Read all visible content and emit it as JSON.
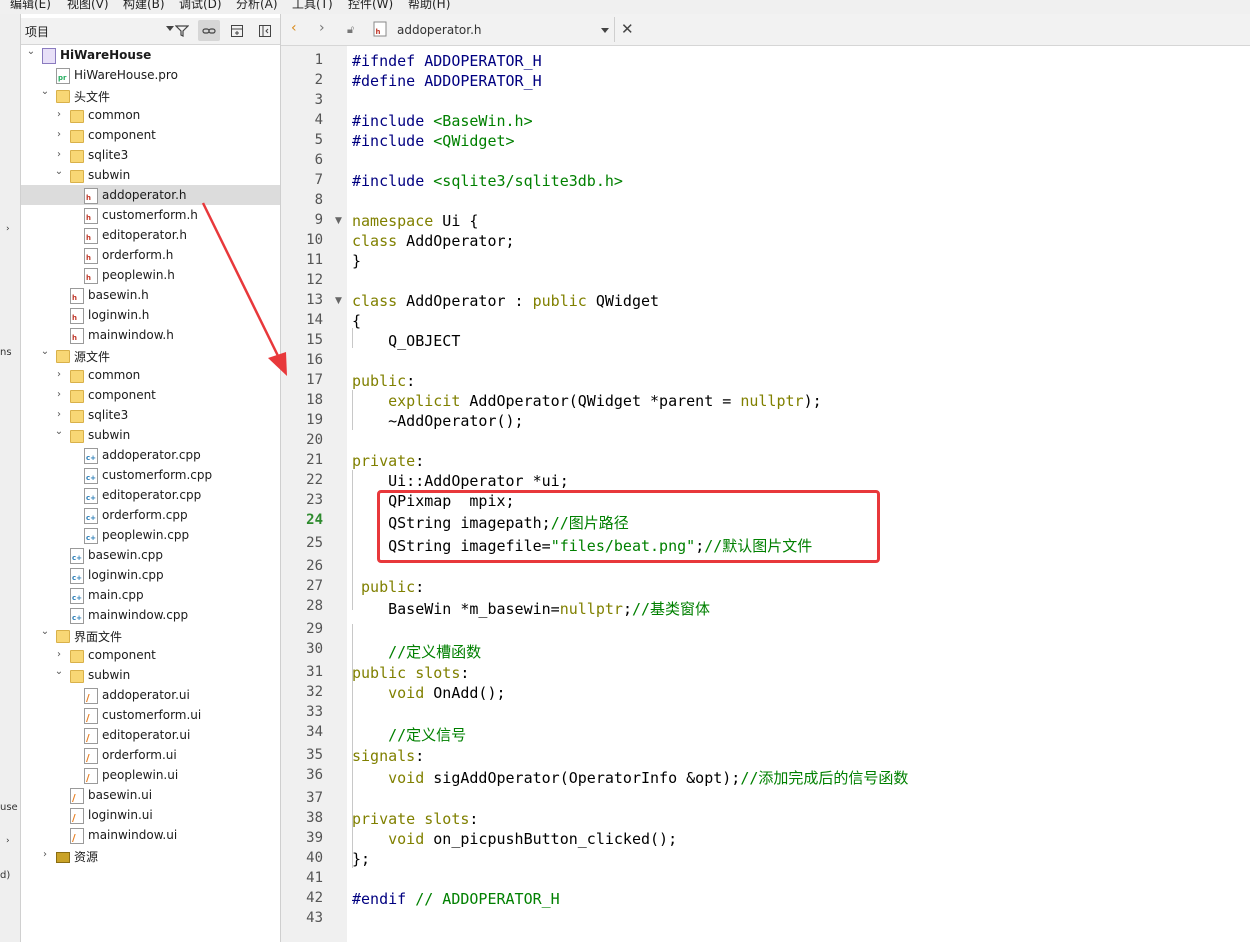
{
  "menubar": {
    "items": [
      "编辑(E)",
      "视图(V)",
      "构建(B)",
      "调试(D)",
      "分析(A)",
      "工具(T)",
      "控件(W)",
      "帮助(H)"
    ]
  },
  "left_strip": {
    "fragments": [
      "ns",
      "use",
      "d)"
    ]
  },
  "project_pane": {
    "title": "项目",
    "tree": [
      {
        "label": "HiWareHouse",
        "icon": "project-icon",
        "expanded": true
      },
      {
        "label": "HiWareHouse.pro",
        "icon": "pro-file-icon"
      },
      {
        "label": "头文件",
        "icon": "headers-folder-icon",
        "expanded": true
      },
      {
        "label": "common",
        "icon": "folder-icon"
      },
      {
        "label": "component",
        "icon": "folder-icon"
      },
      {
        "label": "sqlite3",
        "icon": "folder-icon"
      },
      {
        "label": "subwin",
        "icon": "folder-icon",
        "expanded": true
      },
      {
        "label": "addoperator.h",
        "icon": "header-file-icon",
        "selected": true
      },
      {
        "label": "customerform.h",
        "icon": "header-file-icon"
      },
      {
        "label": "editoperator.h",
        "icon": "header-file-icon"
      },
      {
        "label": "orderform.h",
        "icon": "header-file-icon"
      },
      {
        "label": "peoplewin.h",
        "icon": "header-file-icon"
      },
      {
        "label": "basewin.h",
        "icon": "header-file-icon"
      },
      {
        "label": "loginwin.h",
        "icon": "header-file-icon"
      },
      {
        "label": "mainwindow.h",
        "icon": "header-file-icon"
      },
      {
        "label": "源文件",
        "icon": "sources-folder-icon",
        "expanded": true
      },
      {
        "label": "common",
        "icon": "folder-icon"
      },
      {
        "label": "component",
        "icon": "folder-icon"
      },
      {
        "label": "sqlite3",
        "icon": "folder-icon"
      },
      {
        "label": "subwin",
        "icon": "folder-icon",
        "expanded": true
      },
      {
        "label": "addoperator.cpp",
        "icon": "cpp-file-icon"
      },
      {
        "label": "customerform.cpp",
        "icon": "cpp-file-icon"
      },
      {
        "label": "editoperator.cpp",
        "icon": "cpp-file-icon"
      },
      {
        "label": "orderform.cpp",
        "icon": "cpp-file-icon"
      },
      {
        "label": "peoplewin.cpp",
        "icon": "cpp-file-icon"
      },
      {
        "label": "basewin.cpp",
        "icon": "cpp-file-icon"
      },
      {
        "label": "loginwin.cpp",
        "icon": "cpp-file-icon"
      },
      {
        "label": "main.cpp",
        "icon": "cpp-file-icon"
      },
      {
        "label": "mainwindow.cpp",
        "icon": "cpp-file-icon"
      },
      {
        "label": "界面文件",
        "icon": "forms-folder-icon",
        "expanded": true
      },
      {
        "label": "component",
        "icon": "folder-icon"
      },
      {
        "label": "subwin",
        "icon": "folder-icon",
        "expanded": true
      },
      {
        "label": "addoperator.ui",
        "icon": "ui-file-icon"
      },
      {
        "label": "customerform.ui",
        "icon": "ui-file-icon"
      },
      {
        "label": "editoperator.ui",
        "icon": "ui-file-icon"
      },
      {
        "label": "orderform.ui",
        "icon": "ui-file-icon"
      },
      {
        "label": "peoplewin.ui",
        "icon": "ui-file-icon"
      },
      {
        "label": "basewin.ui",
        "icon": "ui-file-icon"
      },
      {
        "label": "loginwin.ui",
        "icon": "ui-file-icon"
      },
      {
        "label": "mainwindow.ui",
        "icon": "ui-file-icon"
      },
      {
        "label": "资源",
        "icon": "resources-lock-icon",
        "expanded": false
      }
    ]
  },
  "editor": {
    "file_name": "addoperator.h",
    "current_line": "24",
    "lines": [
      {
        "n": "1"
      },
      {
        "n": "2"
      },
      {
        "n": "3"
      },
      {
        "n": "4"
      },
      {
        "n": "5"
      },
      {
        "n": "6"
      },
      {
        "n": "7"
      },
      {
        "n": "8"
      },
      {
        "n": "9"
      },
      {
        "n": "10"
      },
      {
        "n": "11"
      },
      {
        "n": "12"
      },
      {
        "n": "13"
      },
      {
        "n": "14"
      },
      {
        "n": "15"
      },
      {
        "n": "16"
      },
      {
        "n": "17"
      },
      {
        "n": "18"
      },
      {
        "n": "19"
      },
      {
        "n": "20"
      },
      {
        "n": "21"
      },
      {
        "n": "22"
      },
      {
        "n": "23"
      },
      {
        "n": "24"
      },
      {
        "n": "25"
      },
      {
        "n": "26"
      },
      {
        "n": "27"
      },
      {
        "n": "28"
      },
      {
        "n": "29"
      },
      {
        "n": "30"
      },
      {
        "n": "31"
      },
      {
        "n": "32"
      },
      {
        "n": "33"
      },
      {
        "n": "34"
      },
      {
        "n": "35"
      },
      {
        "n": "36"
      },
      {
        "n": "37"
      },
      {
        "n": "38"
      },
      {
        "n": "39"
      },
      {
        "n": "40"
      },
      {
        "n": "41"
      },
      {
        "n": "42"
      },
      {
        "n": "43"
      }
    ],
    "code": [
      [
        {
          "t": "#ifndef ADDOPERATOR_H",
          "c": "pp"
        }
      ],
      [
        {
          "t": "#define ADDOPERATOR_H",
          "c": "pp"
        }
      ],
      [],
      [
        {
          "t": "#include ",
          "c": "pp"
        },
        {
          "t": "<BaseWin.h>",
          "c": "str"
        }
      ],
      [
        {
          "t": "#include ",
          "c": "pp"
        },
        {
          "t": "<QWidget>",
          "c": "str"
        }
      ],
      [],
      [
        {
          "t": "#include ",
          "c": "pp"
        },
        {
          "t": "<sqlite3/sqlite3db.h>",
          "c": "str"
        }
      ],
      [],
      [
        {
          "t": "namespace",
          "c": "kw"
        },
        {
          "t": " Ui {",
          "c": ""
        }
      ],
      [
        {
          "t": "class",
          "c": "kw"
        },
        {
          "t": " AddOperator;",
          "c": ""
        }
      ],
      [
        {
          "t": "}",
          "c": ""
        }
      ],
      [],
      [
        {
          "t": "class",
          "c": "kw"
        },
        {
          "t": " AddOperator : ",
          "c": ""
        },
        {
          "t": "public",
          "c": "kw"
        },
        {
          "t": " QWidget",
          "c": ""
        }
      ],
      [
        {
          "t": "{",
          "c": ""
        }
      ],
      [
        {
          "t": "    Q_OBJECT",
          "c": ""
        }
      ],
      [],
      [
        {
          "t": "public",
          "c": "kw"
        },
        {
          "t": ":",
          "c": ""
        }
      ],
      [
        {
          "t": "    ",
          "c": ""
        },
        {
          "t": "explicit",
          "c": "kw"
        },
        {
          "t": " AddOperator(QWidget *parent = ",
          "c": ""
        },
        {
          "t": "nullptr",
          "c": "kw"
        },
        {
          "t": ");",
          "c": ""
        }
      ],
      [
        {
          "t": "    ~AddOperator();",
          "c": ""
        }
      ],
      [],
      [
        {
          "t": "private",
          "c": "kw"
        },
        {
          "t": ":",
          "c": ""
        }
      ],
      [
        {
          "t": "    Ui::AddOperator *ui;",
          "c": ""
        }
      ],
      [
        {
          "t": "    QPixmap  mpix;",
          "c": ""
        }
      ],
      [
        {
          "t": "    QString imagepath;",
          "c": ""
        },
        {
          "t": "//图片路径",
          "c": "cm"
        }
      ],
      [
        {
          "t": "    QString imagefile=",
          "c": ""
        },
        {
          "t": "\"files/beat.png\"",
          "c": "str"
        },
        {
          "t": ";",
          "c": ""
        },
        {
          "t": "//默认图片文件",
          "c": "cm"
        }
      ],
      [],
      [
        {
          "t": " public",
          "c": "kw"
        },
        {
          "t": ":",
          "c": ""
        }
      ],
      [
        {
          "t": "    BaseWin *m_basewin=",
          "c": ""
        },
        {
          "t": "nullptr",
          "c": "kw"
        },
        {
          "t": ";",
          "c": ""
        },
        {
          "t": "//基类窗体",
          "c": "cm"
        }
      ],
      [],
      [
        {
          "t": "    ",
          "c": ""
        },
        {
          "t": "//定义槽函数",
          "c": "cm"
        }
      ],
      [
        {
          "t": "public slots",
          "c": "kw"
        },
        {
          "t": ":",
          "c": ""
        }
      ],
      [
        {
          "t": "    ",
          "c": ""
        },
        {
          "t": "void",
          "c": "kw"
        },
        {
          "t": " OnAdd();",
          "c": ""
        }
      ],
      [],
      [
        {
          "t": "    ",
          "c": ""
        },
        {
          "t": "//定义信号",
          "c": "cm"
        }
      ],
      [
        {
          "t": "signals",
          "c": "kw"
        },
        {
          "t": ":",
          "c": ""
        }
      ],
      [
        {
          "t": "    ",
          "c": ""
        },
        {
          "t": "void",
          "c": "kw"
        },
        {
          "t": " sigAddOperator(OperatorInfo &opt);",
          "c": ""
        },
        {
          "t": "//添加完成后的信号函数",
          "c": "cm"
        }
      ],
      [],
      [
        {
          "t": "private slots",
          "c": "kw"
        },
        {
          "t": ":",
          "c": ""
        }
      ],
      [
        {
          "t": "    ",
          "c": ""
        },
        {
          "t": "void",
          "c": "kw"
        },
        {
          "t": " on_picpushButton_clicked();",
          "c": ""
        }
      ],
      [
        {
          "t": "};",
          "c": ""
        }
      ],
      [],
      [
        {
          "t": "#endif",
          "c": "pp"
        },
        {
          "t": " // ADDOPERATOR_H",
          "c": "cm"
        }
      ],
      []
    ]
  },
  "colors": {
    "annotation_red": "#e8383b",
    "current_line_number": "#2e8b2e",
    "keyword": "#808000",
    "string": "#008000",
    "preprocessor": "#000080"
  }
}
